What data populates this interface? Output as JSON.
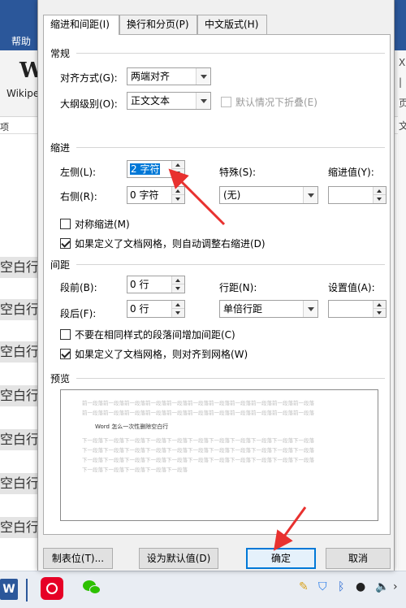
{
  "background": {
    "menu_help": "帮助",
    "logo_letter": "W",
    "logo_text": "Wikipe",
    "side_char": "项",
    "doc_lines": [
      "空白行",
      "空白行",
      "空白行",
      "空白行",
      "空白行",
      "空白行",
      "空白行"
    ],
    "right_chars": [
      "X",
      "|",
      "页",
      "文"
    ]
  },
  "dialog": {
    "tabs": [
      "缩进和间距(I)",
      "换行和分页(P)",
      "中文版式(H)"
    ],
    "general": {
      "section": "常规",
      "alignment_label": "对齐方式(G):",
      "alignment_value": "两端对齐",
      "outline_label": "大纲级别(O):",
      "outline_value": "正文文本",
      "collapse_label": "默认情况下折叠(E)"
    },
    "indent": {
      "section": "缩进",
      "left_label": "左侧(L):",
      "left_value": "2 字符",
      "right_label": "右侧(R):",
      "right_value": "0 字符",
      "special_label": "特殊(S):",
      "special_value": "(无)",
      "indent_value_label": "缩进值(Y):",
      "mirror_label": "对称缩进(M)",
      "auto_adjust_label": "如果定义了文档网格，则自动调整右缩进(D)"
    },
    "spacing": {
      "section": "间距",
      "before_label": "段前(B):",
      "before_value": "0 行",
      "after_label": "段后(F):",
      "after_value": "0 行",
      "line_spacing_label": "行距(N):",
      "line_spacing_value": "单倍行距",
      "set_value_label": "设置值(A):",
      "no_space_label": "不要在相同样式的段落间增加间距(C)",
      "snap_grid_label": "如果定义了文档网格，则对齐到网格(W)"
    },
    "preview": {
      "section": "预览",
      "prev_lines": [
        "前一段落前一段落前一段落前一段落前一段落前一段落前一段落前一段落前一段落前一段落前一段落",
        "前一段落前一段落前一段落前一段落前一段落前一段落前一段落前一段落前一段落前一段落前一段落"
      ],
      "sample_text": "Word 怎么一次性删除空白行",
      "next_lines": [
        "下一段落下一段落下一段落下一段落下一段落下一段落下一段落下一段落下一段落下一段落下一段落",
        "下一段落下一段落下一段落下一段落下一段落下一段落下一段落下一段落下一段落下一段落下一段落",
        "下一段落下一段落下一段落下一段落下一段落下一段落下一段落下一段落下一段落下一段落下一段落",
        "下一段落下一段落下一段落下一段落下一段落"
      ]
    },
    "buttons": {
      "tabs": "制表位(T)...",
      "set_default": "设为默认值(D)",
      "ok": "确定",
      "cancel": "取消"
    }
  },
  "taskbar": {
    "word_letter": "W"
  },
  "colors": {
    "accent": "#0078d7",
    "annotation_arrow": "#e8312f"
  }
}
